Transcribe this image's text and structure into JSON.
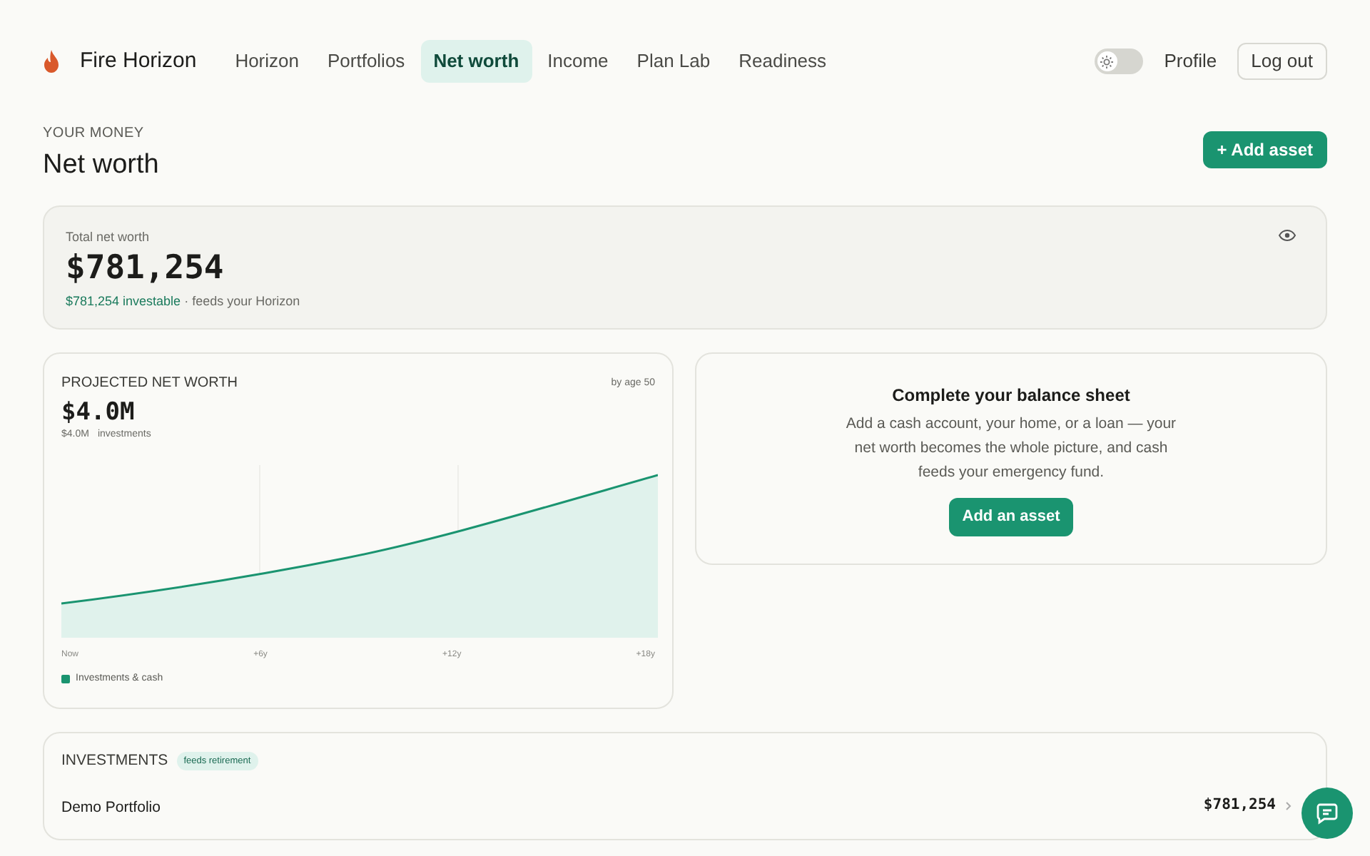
{
  "brand": {
    "name": "Fire Horizon"
  },
  "nav": [
    {
      "label": "Horizon",
      "selected": false
    },
    {
      "label": "Portfolios",
      "selected": false
    },
    {
      "label": "Net worth",
      "selected": true
    },
    {
      "label": "Income",
      "selected": false
    },
    {
      "label": "Plan Lab",
      "selected": false
    },
    {
      "label": "Readiness",
      "selected": false
    }
  ],
  "theme_toggle": {
    "on": false
  },
  "profile_link": "Profile",
  "logout_button": "Log out",
  "page": {
    "eyebrow": "YOUR MONEY",
    "title": "Net worth",
    "add_button": "+ Add asset"
  },
  "total": {
    "label": "Total net worth",
    "value": "$781,254",
    "investable": "$781,254 investable",
    "note": "· feeds your Horizon"
  },
  "projection": {
    "title": "PROJECTED NET WORTH",
    "age_note": "by age 50",
    "value": "$4.0M",
    "sub_value": "$4.0M",
    "sub_label": "investments",
    "x_labels": [
      "Now",
      "+6y",
      "+12y",
      "+18y"
    ],
    "legend": {
      "label": "Investments & cash",
      "color": "#1a9470"
    }
  },
  "balance_sheet": {
    "title": "Complete your balance sheet",
    "text": "Add a cash account, your home, or a loan — your net worth becomes the whole picture, and cash feeds your emergency fund.",
    "button": "Add an asset"
  },
  "investments": {
    "title": "INVESTMENTS",
    "badge": "feeds retirement",
    "rows": [
      {
        "name": "Demo Portfolio",
        "value": "$781,254"
      }
    ]
  }
}
